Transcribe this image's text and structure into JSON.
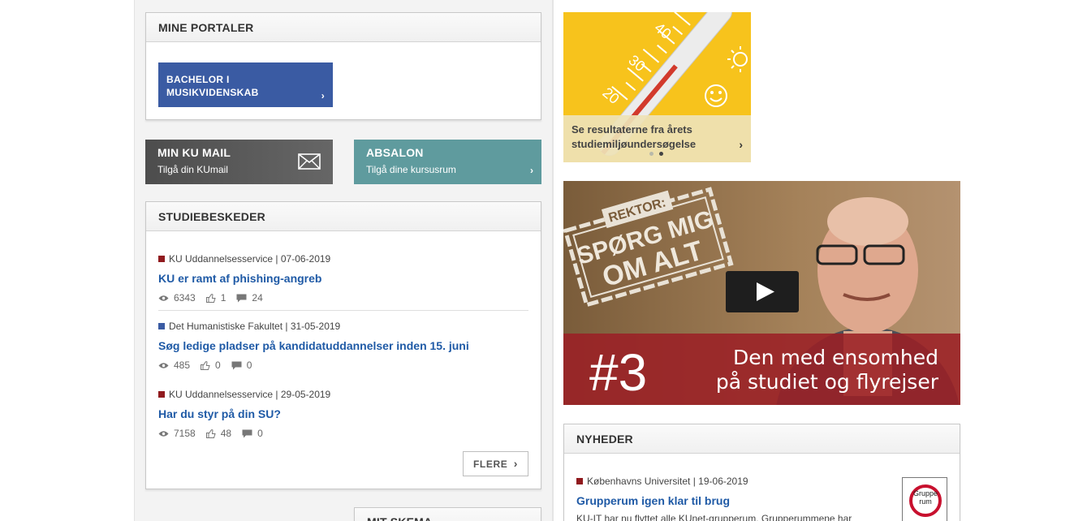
{
  "portals": {
    "title": "MINE PORTALER",
    "button_label": "BACHELOR I MUSIKVIDENSKAB",
    "chevron": "›"
  },
  "mail": {
    "title": "MIN KU MAIL",
    "subtitle": "Tilgå din KUmail",
    "icon": "envelope-icon"
  },
  "absalon": {
    "title": "ABSALON",
    "subtitle": "Tilgå dine kursusrum",
    "chevron": "›"
  },
  "studiebeskeder": {
    "title": "STUDIEBESKEDER",
    "messages": [
      {
        "source": "KU Uddannelsesservice | 07-06-2019",
        "color": "#901a1e",
        "title": "KU er ramt af phishing-angreb",
        "views": "6343",
        "likes": "1",
        "comments": "24"
      },
      {
        "source": "Det Humanistiske Fakultet | 31-05-2019",
        "color": "#3a5ba3",
        "title": "Søg ledige pladser på kandidatuddannelser inden 15. juni",
        "views": "485",
        "likes": "0",
        "comments": "0"
      },
      {
        "source": "KU Uddannelsesservice | 29-05-2019",
        "color": "#901a1e",
        "title": "Har du styr på din SU?",
        "views": "7158",
        "likes": "48",
        "comments": "0"
      }
    ],
    "more_label": "FLERE",
    "more_arrow": "›"
  },
  "skema": {
    "title": "MIT SKEMA"
  },
  "promo": {
    "caption": "Se resultaterne fra årets studiemiljøundersøgelse",
    "chevron": "›",
    "scale": [
      "20",
      "30",
      "40"
    ]
  },
  "video": {
    "stamp_line1": "REKTOR:",
    "stamp_line2": "SPØRG MIG",
    "stamp_line3": "OM ALT",
    "number": "#3",
    "caption_line1": "Den med ensomhed",
    "caption_line2": "på studiet og flyrejser"
  },
  "news": {
    "title": "NYHEDER",
    "item": {
      "source": "Københavns Universitet | 19-06-2019",
      "color": "#901a1e",
      "title": "Grupperum igen klar til brug",
      "snippet": "KU-IT har nu flyttet alle KUnet-grupperum. Grupperummene har",
      "thumb_text": "Gruppe rum"
    }
  },
  "colors": {
    "ku_red": "#901a1e",
    "ku_blue": "#3a5ba3",
    "link": "#1f5aa6",
    "mail_tile": "#5a5a5a",
    "absalon_tile": "#5f9b9e",
    "promo_yellow": "#f7c31c"
  }
}
